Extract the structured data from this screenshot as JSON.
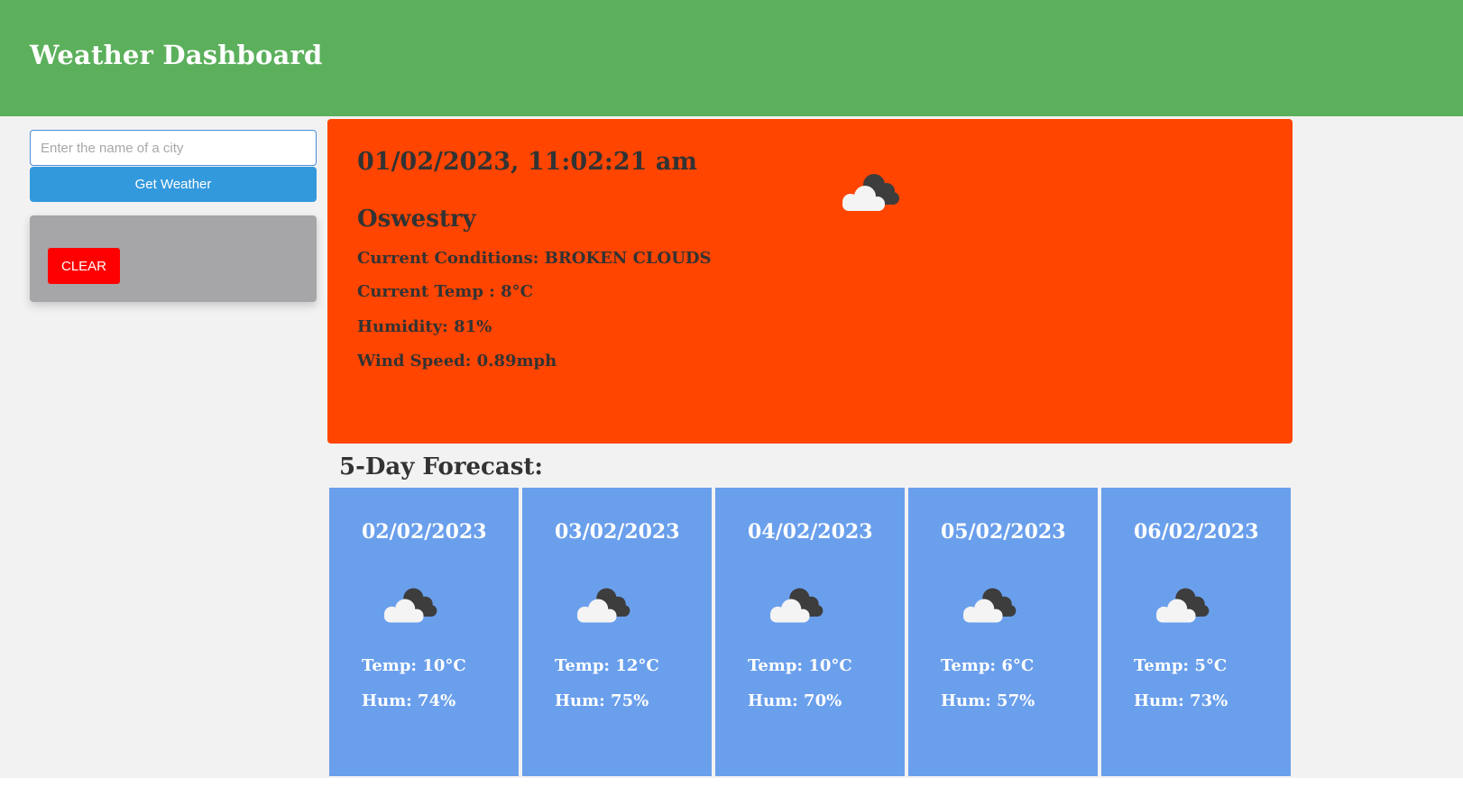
{
  "header": {
    "title": "Weather Dashboard"
  },
  "search": {
    "placeholder": "Enter the name of a city",
    "value": "",
    "button_label": "Get Weather"
  },
  "history": {
    "clear_label": "CLEAR"
  },
  "current": {
    "datetime": "01/02/2023, 11:02:21 am",
    "city": "Oswestry",
    "icon": "broken-clouds-icon",
    "conditions": "Current Conditions: BROKEN CLOUDS",
    "temp": "Current Temp : 8°C",
    "humidity": "Humidity: 81%",
    "wind": "Wind Speed: 0.89mph"
  },
  "forecast": {
    "heading": "5-Day Forecast:",
    "days": [
      {
        "date": "02/02/2023",
        "icon": "broken-clouds-icon",
        "temp": "Temp: 10°C",
        "hum": "Hum: 74%"
      },
      {
        "date": "03/02/2023",
        "icon": "broken-clouds-icon",
        "temp": "Temp: 12°C",
        "hum": "Hum: 75%"
      },
      {
        "date": "04/02/2023",
        "icon": "broken-clouds-icon",
        "temp": "Temp: 10°C",
        "hum": "Hum: 70%"
      },
      {
        "date": "05/02/2023",
        "icon": "broken-clouds-icon",
        "temp": "Temp: 6°C",
        "hum": "Hum: 57%"
      },
      {
        "date": "06/02/2023",
        "icon": "broken-clouds-icon",
        "temp": "Temp: 5°C",
        "hum": "Hum: 73%"
      }
    ]
  },
  "colors": {
    "header": "#5cb05c",
    "current_card": "#ff4500",
    "forecast_card": "#6a9fec",
    "get_weather_button": "#3399dd",
    "clear_button": "#ff0000",
    "history_panel": "#a6a6a8"
  }
}
